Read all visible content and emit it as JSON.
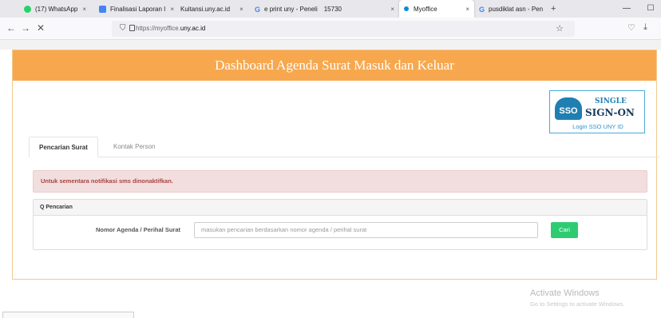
{
  "browser": {
    "tabs": [
      {
        "label": "(17) WhatsApp",
        "icon": "whatsapp-icon",
        "color": "#25d366",
        "close": "×"
      },
      {
        "label": "Finalisasi Laporan I",
        "icon": "document-icon",
        "color": "#4285f4",
        "close": "×"
      },
      {
        "label": "Kuitansi.uny.ac.id",
        "icon": "",
        "color": "",
        "close": "×"
      },
      {
        "label": "e print uny - Peneli",
        "icon": "google-icon",
        "color": "#4285f4",
        "close": "×",
        "extra": "15730"
      },
      {
        "label": "Myoffice",
        "icon": "loading-dot-icon",
        "color": "#0b8dde",
        "close": "×"
      },
      {
        "label": "pusdiklat asn - Pen",
        "icon": "google-icon",
        "color": "#4285f4",
        "close": "×"
      }
    ],
    "new_tab": "+",
    "minimize": "—",
    "maximize": "☐",
    "url_prefix": "https://myoffice.",
    "url_host": "uny.ac.id"
  },
  "page": {
    "header_title": "Dashboard Agenda Surat Masuk dan Keluar",
    "sso": {
      "logo_text": "SSO",
      "line1": "SINGLE",
      "line2": "SIGN-ON",
      "login_text": "Login SSO UNY ID"
    },
    "tabs": [
      {
        "label": "Pencarian Surat",
        "active": true
      },
      {
        "label": "Kontak Person",
        "active": false
      }
    ],
    "alert_text": "Untuk sementara notifikasi sms dinonaktifkan.",
    "search_panel": {
      "title": "Q Pencarian",
      "field_label": "Nomor Agenda / Perihal Surat",
      "placeholder": "masukan pencarian berdasarkan nomor agenda / perihal surat",
      "button_label": "Cari"
    },
    "colors": {
      "header": "#f7a84e",
      "alert_bg": "#f2dede",
      "alert_text": "#a94442",
      "button": "#2ecc71"
    }
  },
  "os": {
    "watermark_line1": "Activate Windows",
    "watermark_line2": "Go to Settings to activate Windows."
  }
}
